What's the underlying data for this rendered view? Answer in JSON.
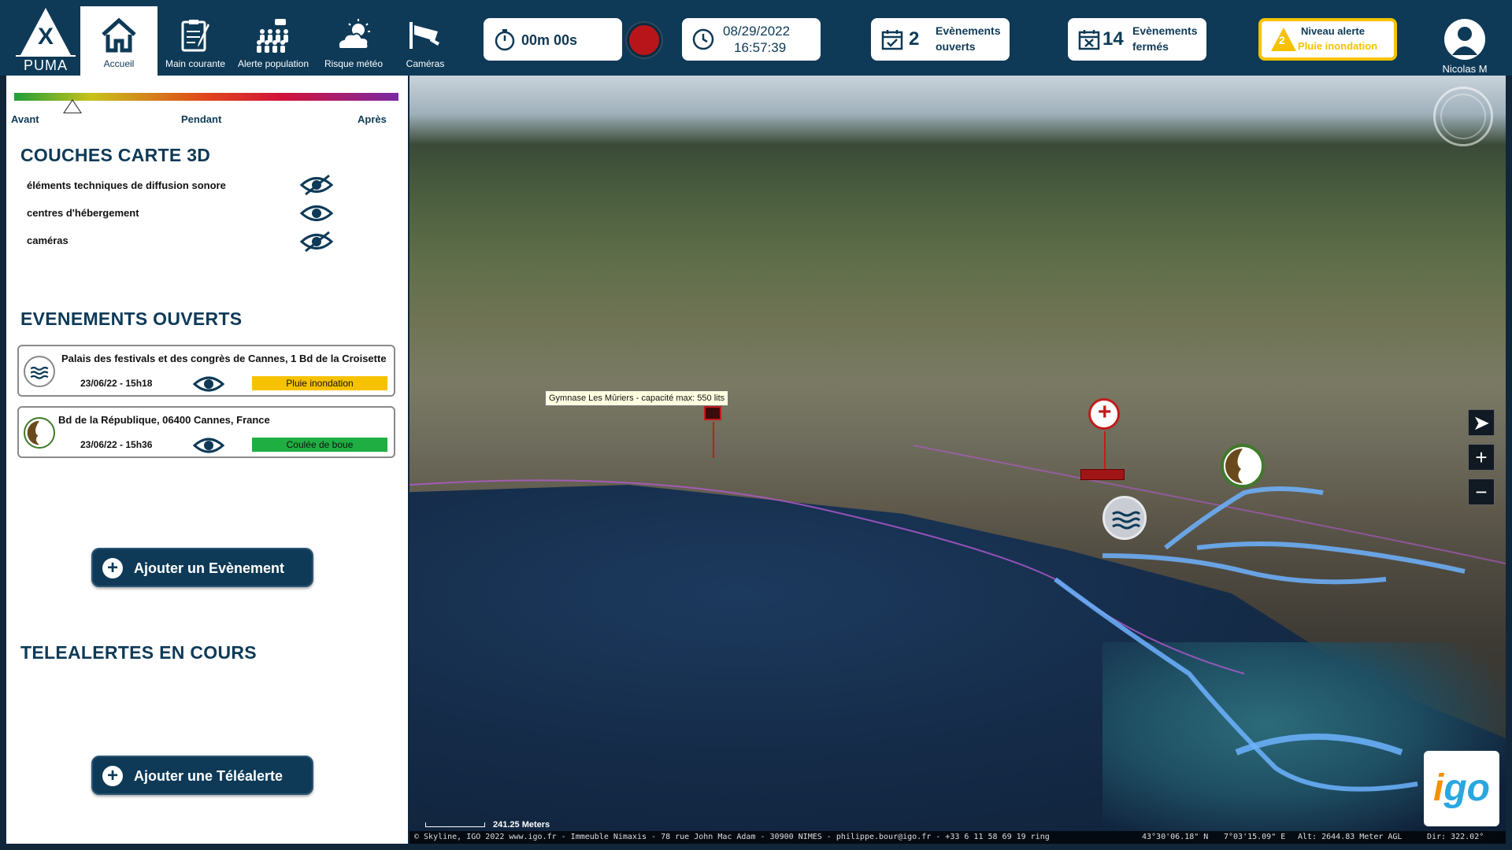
{
  "app": {
    "logo_mark": "X",
    "logo_name": "PUMA"
  },
  "nav": [
    {
      "id": "accueil",
      "label": "Accueil",
      "icon": "home-icon",
      "active": true
    },
    {
      "id": "main-courante",
      "label": "Main courante",
      "icon": "clipboard-icon"
    },
    {
      "id": "alerte-population",
      "label": "Alerte population",
      "icon": "population-icon"
    },
    {
      "id": "risque-meteo",
      "label": "Risque météo",
      "icon": "weather-icon"
    },
    {
      "id": "cameras",
      "label": "Caméras",
      "icon": "camera-icon"
    }
  ],
  "status": {
    "timer": "00m 00s",
    "date": "08/29/2022",
    "time": "16:57:39",
    "open_count": "2",
    "open_label_1": "Evènements",
    "open_label_2": "ouverts",
    "closed_count": "14",
    "closed_label_1": "Evènements",
    "closed_label_2": "fermés",
    "alert_level_num": "2",
    "alert_title": "Niveau alerte",
    "alert_type": "Pluie inondation",
    "user_name": "Nicolas M",
    "colors": {
      "primary": "#0e3a57",
      "alert": "#f6c200",
      "record": "#b8151b"
    }
  },
  "timeline": {
    "before": "Avant",
    "during": "Pendant",
    "after": "Après",
    "position": 0.15
  },
  "layers": {
    "title": "COUCHES CARTE 3D",
    "items": [
      {
        "label": "éléments techniques de diffusion sonore",
        "visible": false
      },
      {
        "label": "centres d'hébergement",
        "visible": true
      },
      {
        "label": "caméras",
        "visible": false
      }
    ]
  },
  "events": {
    "title": "EVENEMENTS OUVERTS",
    "items": [
      {
        "title": "Palais des festivals et des congrès de Cannes, 1 Bd de la Croisette",
        "date": "23/06/22 - 15h18",
        "tag": "Pluie inondation",
        "tag_color": "#f6c200",
        "icon": "flood-icon"
      },
      {
        "title": "Bd de la République, 06400 Cannes, France",
        "date": "23/06/22 - 15h36",
        "tag": "Coulée de boue",
        "tag_color": "#1fae42",
        "icon": "mudslide-icon"
      }
    ],
    "add_label": "Ajouter un Evènement"
  },
  "telealerts": {
    "title": "TELEALERTES EN COURS",
    "add_label": "Ajouter une Téléalerte"
  },
  "map": {
    "tooltip": "Gymnase Les Mûriers - capacité max: 550 lits",
    "scale": "241.25 Meters",
    "copyright": "© Skyline, IGO 2022 www.igo.fr - Immeuble Nimaxis - 78 rue John Mac Adam - 30900 NIMES - philippe.bour@igo.fr - +33 6 11 58 69 19 ring",
    "lat": "43°30'06.18\" N",
    "lon": "7°03'15.09\" E",
    "alt": "Alt: 2644.83 Meter AGL",
    "dir": "Dir: 322.02°",
    "logo_i": "i",
    "logo_go": "go"
  }
}
